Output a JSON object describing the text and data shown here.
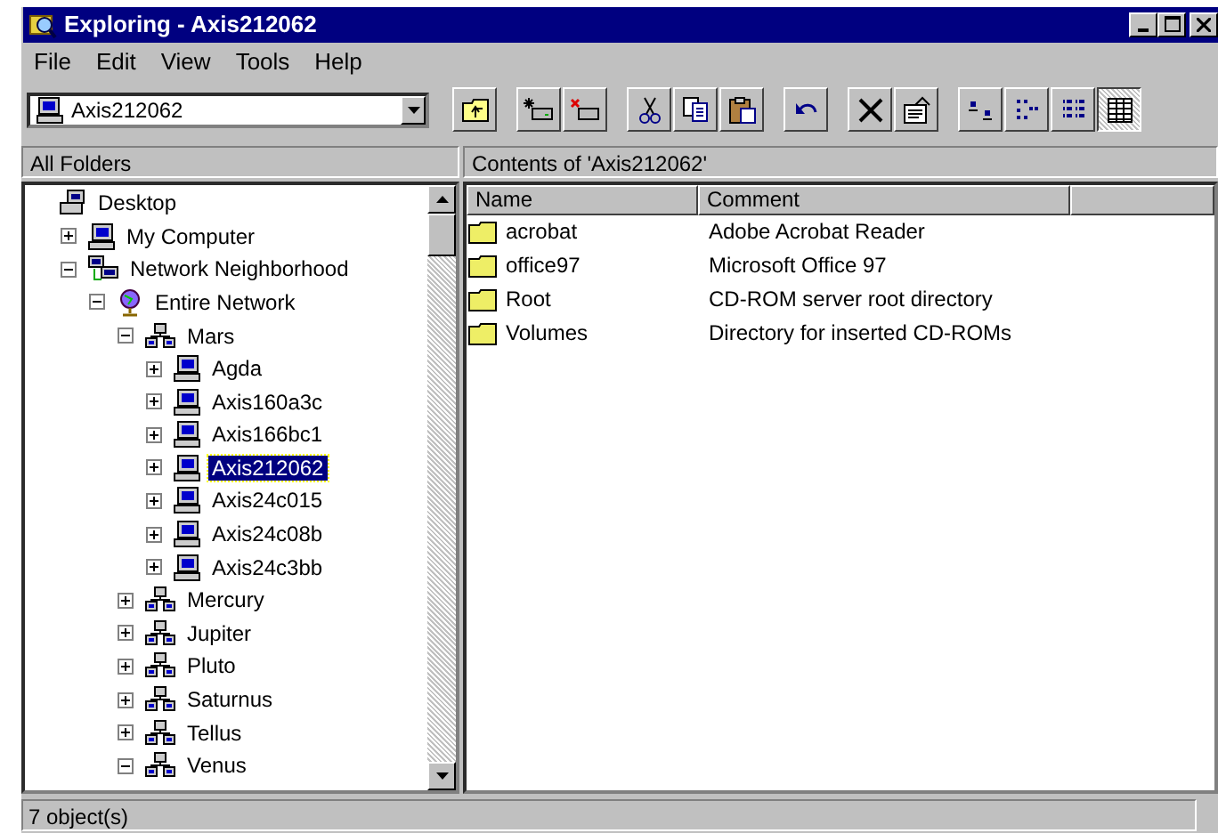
{
  "window": {
    "title": "Exploring - Axis212062"
  },
  "menu": [
    "File",
    "Edit",
    "View",
    "Tools",
    "Help"
  ],
  "address": {
    "value": "Axis212062"
  },
  "toolbar": [
    {
      "kind": "up",
      "pressed": false
    },
    {
      "kind": "map-drive",
      "pressed": false
    },
    {
      "kind": "disconnect",
      "pressed": false
    },
    {
      "kind": "cut",
      "pressed": false
    },
    {
      "kind": "copy",
      "pressed": false
    },
    {
      "kind": "paste",
      "pressed": false
    },
    {
      "kind": "undo",
      "pressed": false
    },
    {
      "kind": "delete",
      "pressed": false
    },
    {
      "kind": "properties",
      "pressed": false
    },
    {
      "kind": "large-icons",
      "pressed": false
    },
    {
      "kind": "small-icons",
      "pressed": false
    },
    {
      "kind": "list",
      "pressed": false
    },
    {
      "kind": "details",
      "pressed": true
    }
  ],
  "left_header": "All Folders",
  "right_header": "Contents of 'Axis212062'",
  "tree": [
    {
      "label": "Desktop",
      "kind": "desktop",
      "selected": false,
      "children": [
        {
          "label": "My Computer",
          "kind": "computer",
          "expanded": false,
          "selected": false
        },
        {
          "label": "Network Neighborhood",
          "kind": "network",
          "expanded": true,
          "selected": false,
          "children": [
            {
              "label": "Entire Network",
              "kind": "globe",
              "expanded": true,
              "selected": false,
              "children": [
                {
                  "label": "Mars",
                  "kind": "workgroup",
                  "expanded": true,
                  "selected": false,
                  "children": [
                    {
                      "label": "Agda",
                      "kind": "computer",
                      "expanded": false,
                      "selected": false
                    },
                    {
                      "label": "Axis160a3c",
                      "kind": "computer",
                      "expanded": false,
                      "selected": false
                    },
                    {
                      "label": "Axis166bc1",
                      "kind": "computer",
                      "expanded": false,
                      "selected": false
                    },
                    {
                      "label": "Axis212062",
                      "kind": "computer",
                      "expanded": false,
                      "selected": true
                    },
                    {
                      "label": "Axis24c015",
                      "kind": "computer",
                      "expanded": false,
                      "selected": false
                    },
                    {
                      "label": "Axis24c08b",
                      "kind": "computer",
                      "expanded": false,
                      "selected": false
                    },
                    {
                      "label": "Axis24c3bb",
                      "kind": "computer",
                      "expanded": false,
                      "selected": false
                    }
                  ]
                },
                {
                  "label": "Mercury",
                  "kind": "workgroup",
                  "expanded": false,
                  "selected": false
                },
                {
                  "label": "Jupiter",
                  "kind": "workgroup",
                  "expanded": false,
                  "selected": false
                },
                {
                  "label": "Pluto",
                  "kind": "workgroup",
                  "expanded": false,
                  "selected": false
                },
                {
                  "label": "Saturnus",
                  "kind": "workgroup",
                  "expanded": false,
                  "selected": false
                },
                {
                  "label": "Tellus",
                  "kind": "workgroup",
                  "expanded": false,
                  "selected": false
                },
                {
                  "label": "Venus",
                  "kind": "workgroup",
                  "expanded": true,
                  "selected": false
                }
              ]
            }
          ]
        }
      ]
    }
  ],
  "table": {
    "columns": [
      "Name",
      "Comment"
    ],
    "rows": [
      {
        "name": "acrobat",
        "comment": "Adobe Acrobat Reader"
      },
      {
        "name": "office97",
        "comment": "Microsoft Office 97"
      },
      {
        "name": "Root",
        "comment": "CD-ROM server root directory"
      },
      {
        "name": "Volumes",
        "comment": "Directory for inserted CD-ROMs"
      }
    ]
  },
  "status_bar": "7 object(s)"
}
